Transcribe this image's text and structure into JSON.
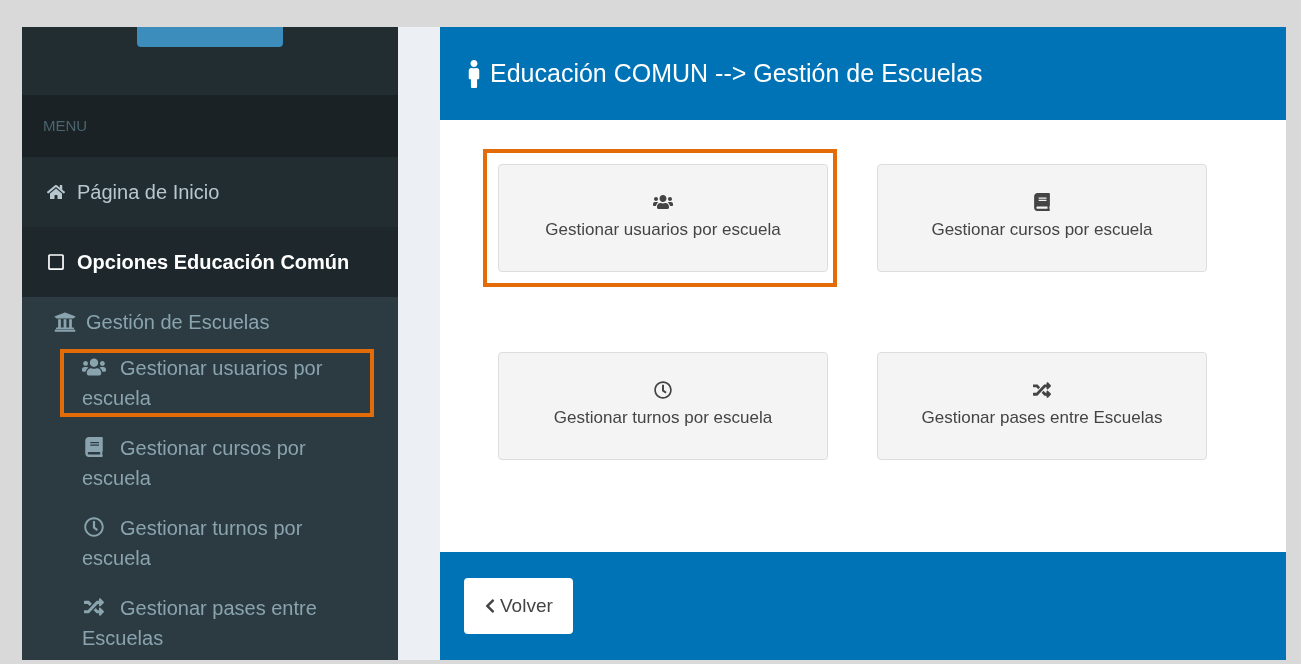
{
  "sidebar": {
    "menu_header": "MENU",
    "items": [
      {
        "label": "Página de Inicio",
        "kind": "home",
        "active": false
      },
      {
        "label": "Opciones Educación Común",
        "kind": "square",
        "active": true
      }
    ],
    "group": {
      "label": "Gestión de Escuelas",
      "kind": "bank",
      "children": [
        {
          "label": "Gestionar usuarios por escuela",
          "kind": "users",
          "highlighted": true
        },
        {
          "label": "Gestionar cursos por escuela",
          "kind": "book",
          "highlighted": false
        },
        {
          "label": "Gestionar turnos por escuela",
          "kind": "clock",
          "highlighted": false
        },
        {
          "label": "Gestionar pases entre Escuelas",
          "kind": "shuffle",
          "highlighted": false
        }
      ]
    }
  },
  "panel": {
    "title": "Educación COMUN --> Gestión de Escuelas",
    "tiles": [
      {
        "label": "Gestionar usuarios por escuela",
        "kind": "users",
        "highlighted": true
      },
      {
        "label": "Gestionar cursos por escuela",
        "kind": "book",
        "highlighted": false
      },
      {
        "label": "Gestionar turnos por escuela",
        "kind": "clock",
        "highlighted": false
      },
      {
        "label": "Gestionar pases entre Escuelas",
        "kind": "shuffle",
        "highlighted": false
      }
    ],
    "back_button": "Volver"
  }
}
